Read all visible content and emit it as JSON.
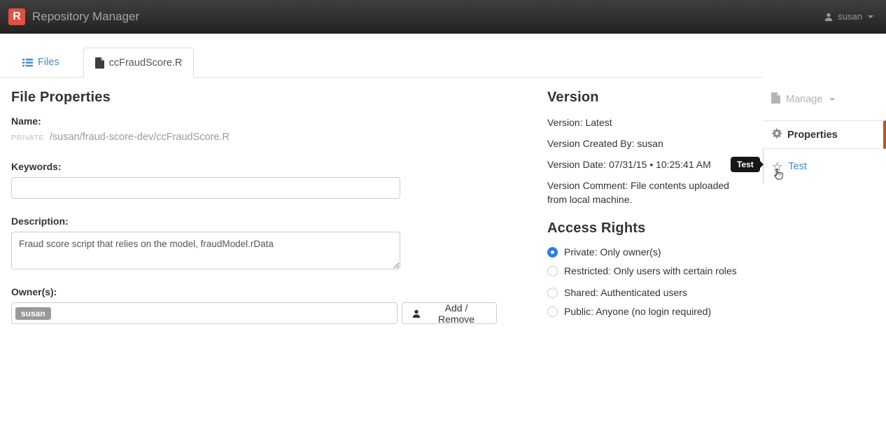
{
  "header": {
    "logo_letter": "R",
    "app_title": "Repository Manager",
    "user": "susan"
  },
  "tabs": [
    {
      "label": "Files"
    },
    {
      "label": "ccFraudScore.R"
    }
  ],
  "file_properties": {
    "title": "File Properties",
    "name_label": "Name:",
    "name_visibility": "PRIVATE",
    "name_path": "/susan/fraud-score-dev/ccFraudScore.R",
    "keywords_label": "Keywords:",
    "keywords_value": "",
    "description_label": "Description:",
    "description_value": "Fraud score script that relies on the model, fraudModel.rData",
    "owners_label": "Owner(s):",
    "owners": [
      "susan"
    ],
    "add_remove_label": "Add / Remove"
  },
  "version": {
    "title": "Version",
    "version_line": "Version: Latest",
    "created_by_line": "Version Created By: susan",
    "date_line": "Version Date: 07/31/15 • 10:25:41 AM",
    "comment_line": "Version Comment: File contents uploaded from local machine."
  },
  "access_rights": {
    "title": "Access Rights",
    "options": [
      {
        "label": "Private: Only owner(s)",
        "selected": true
      },
      {
        "label": "Restricted: Only users with certain roles",
        "selected": false
      },
      {
        "label": "Shared: Authenticated users",
        "selected": false
      },
      {
        "label": "Public: Anyone (no login required)",
        "selected": false
      }
    ]
  },
  "sidebar": {
    "manage_label": "Manage",
    "properties_label": "Properties",
    "test_label": "Test",
    "tooltip": "Test"
  },
  "colors": {
    "logo_red": "#e0523f",
    "link_blue": "#428bca",
    "accent_orange": "#c0561e",
    "radio_selected_blue": "#2e7ce8"
  }
}
